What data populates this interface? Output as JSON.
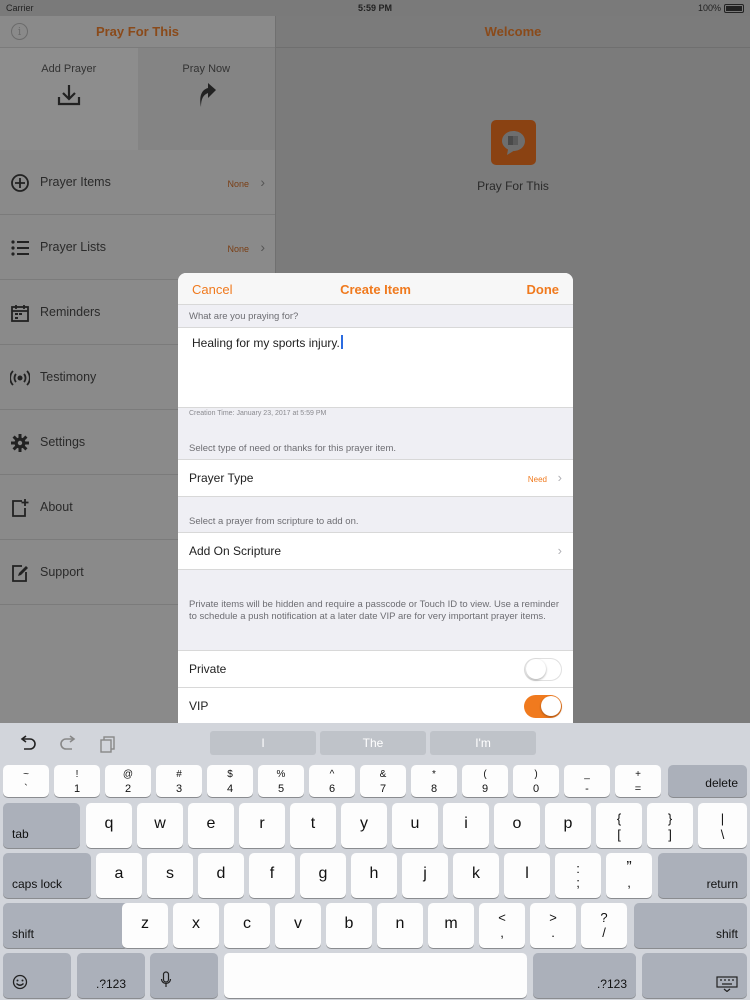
{
  "status_bar": {
    "carrier": "Carrier",
    "time": "5:59 PM",
    "battery": "100%"
  },
  "sidebar": {
    "title": "Pray For This",
    "actions": [
      {
        "label": "Add Prayer",
        "icon": "download-icon"
      },
      {
        "label": "Pray Now",
        "icon": "arrow-up-icon"
      }
    ],
    "items": [
      {
        "label": "Prayer Items",
        "value": "None",
        "icon": "plus-circle-icon"
      },
      {
        "label": "Prayer Lists",
        "value": "None",
        "icon": "list-icon"
      },
      {
        "label": "Reminders",
        "value": "",
        "icon": "calendar-icon"
      },
      {
        "label": "Testimony",
        "value": "",
        "icon": "broadcast-icon"
      },
      {
        "label": "Settings",
        "value": "",
        "icon": "gear-icon"
      },
      {
        "label": "About",
        "value": "",
        "icon": "about-icon"
      },
      {
        "label": "Support",
        "value": "",
        "icon": "edit-icon"
      }
    ]
  },
  "detail": {
    "title": "Welcome",
    "app_name": "Pray For This"
  },
  "modal": {
    "cancel": "Cancel",
    "title": "Create Item",
    "done": "Done",
    "question": "What are you praying for?",
    "text": "Healing for my sports injury.",
    "creation_time": "Creation Time: January 23, 2017 at 5:59 PM",
    "type_hint": "Select type of need or thanks for this prayer item.",
    "prayer_type_label": "Prayer Type",
    "prayer_type_value": "Need",
    "scripture_hint": "Select a prayer from scripture to add on.",
    "scripture_label": "Add On Scripture",
    "private_hint": "Private items will be hidden and require a passcode or Touch ID to view. Use a reminder to schedule a push notification at a later date VIP are for very important prayer items.",
    "private_label": "Private",
    "private_on": false,
    "vip_label": "VIP",
    "vip_on": true
  },
  "keyboard": {
    "suggestions": [
      "I",
      "The",
      "I'm"
    ],
    "row1": [
      {
        "top": "~",
        "bot": "`"
      },
      {
        "top": "!",
        "bot": "1"
      },
      {
        "top": "@",
        "bot": "2"
      },
      {
        "top": "#",
        "bot": "3"
      },
      {
        "top": "$",
        "bot": "4"
      },
      {
        "top": "%",
        "bot": "5"
      },
      {
        "top": "^",
        "bot": "6"
      },
      {
        "top": "&",
        "bot": "7"
      },
      {
        "top": "*",
        "bot": "8"
      },
      {
        "top": "(",
        "bot": "9"
      },
      {
        "top": ")",
        "bot": "0"
      },
      {
        "top": "_",
        "bot": "-"
      },
      {
        "top": "+",
        "bot": "="
      }
    ],
    "delete": "delete",
    "tab": "tab",
    "row2": [
      "q",
      "w",
      "e",
      "r",
      "t",
      "y",
      "u",
      "i",
      "o",
      "p"
    ],
    "row2_extra": [
      {
        "top": "{",
        "bot": "["
      },
      {
        "top": "}",
        "bot": "]"
      },
      {
        "top": "|",
        "bot": "\\"
      }
    ],
    "caps_lock": "caps lock",
    "row3": [
      "a",
      "s",
      "d",
      "f",
      "g",
      "h",
      "j",
      "k",
      "l"
    ],
    "row3_extra": [
      {
        "top": ":",
        "bot": ";"
      },
      {
        "top": "”",
        "bot": ","
      }
    ],
    "return": "return",
    "shift": "shift",
    "row4": [
      "z",
      "x",
      "c",
      "v",
      "b",
      "n",
      "m"
    ],
    "row4_extra": [
      {
        "top": "<",
        "bot": ","
      },
      {
        "top": ">",
        "bot": "."
      },
      {
        "top": "?",
        "bot": "/"
      }
    ],
    "numbers": ".?123"
  }
}
